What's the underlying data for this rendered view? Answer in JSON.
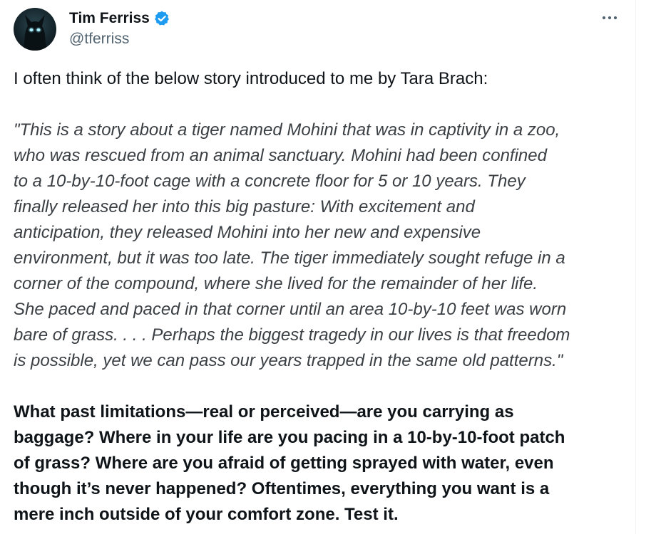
{
  "author": {
    "display_name": "Tim Ferriss",
    "handle": "@tferriss",
    "verified": true,
    "verified_color": "#1d9bf0",
    "avatar_icon": "wolf-avatar"
  },
  "menu": {
    "icon": "more-horizontal-icon"
  },
  "tweet": {
    "intro": "I often think of the below story introduced to me by Tara Brach:",
    "quote_lines": [
      "\"This is a story about a tiger named Mohini that was in captivity in a zoo,",
      "who was rescued from an animal sanctuary. Mohini had been confined",
      "to a 10-by-10-foot cage with a concrete floor for 5 or 10 years. They",
      "finally released her into this big pasture: With excitement and",
      "anticipation, they released Mohini into her new and expensive",
      "environment, but it was too late. The tiger immediately sought refuge in a",
      "corner of the compound, where she lived for the remainder of her life.",
      "She paced and paced in that corner until an area 10-by-10 feet was worn",
      "bare of grass. . . . Perhaps the biggest tragedy in our lives is that freedom",
      "is possible, yet we can pass our years trapped in the same old patterns.\""
    ],
    "question_lines": [
      "What past limitations—real or perceived—are you carrying as",
      "baggage? Where in your life are you pacing in a 10-by-10-foot patch",
      "of grass? Where are you afraid of getting sprayed with water, even",
      "though it’s never happened? Oftentimes, everything you want is a",
      "mere inch outside of your comfort zone. Test it."
    ]
  }
}
